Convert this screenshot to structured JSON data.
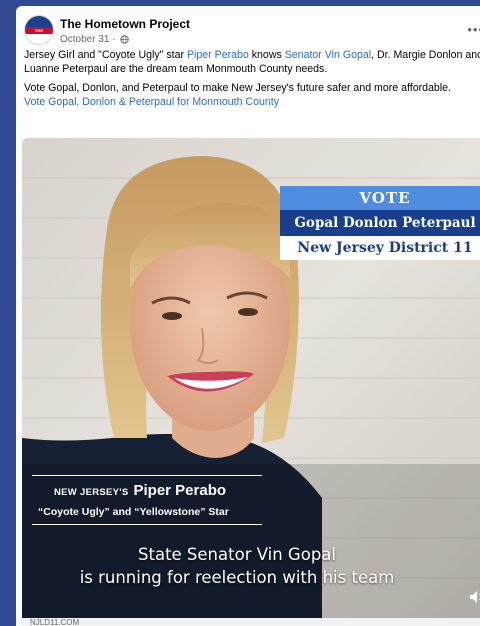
{
  "post": {
    "page_name": "The Hometown Project",
    "date": "October 31",
    "date_separator": " · ",
    "more_icon": "more-horizontal-icon",
    "privacy_icon": "globe-icon",
    "avatar_text": "THE HOMETOWN PROJECT"
  },
  "body": {
    "p1": {
      "pre": "Jersey Girl and \"Coyote Ugly\" star ",
      "link1": "Piper Perabo",
      "mid": " knows ",
      "link2": "Senator Vin Gopal",
      "post": ", Dr. Margie Donlon and",
      "line2": "Luanne Peterpaul are the dream team Monmouth County needs."
    },
    "p2": {
      "text": "Vote Gopal, Donlon, and Peterpaul to make New Jersey's future safer and more affordable.",
      "link": "Vote Gopal, Donlon & Peterpaul for Monmouth County"
    }
  },
  "video": {
    "vote_header": "VOTE",
    "vote_names": "Gopal Donlon Peterpaul",
    "vote_district": "New Jersey District 11",
    "lower_third_prefix": "NEW JERSEY'S",
    "lower_third_name": "Piper Perabo",
    "lower_third_role": "“Coyote Ugly” and “Yellowstone” Star",
    "caption_line1": "State Senator Vin Gopal",
    "caption_line2": "is running for reelection with his team",
    "volume_icon": "volume-icon"
  },
  "footer": {
    "domain": "NJLD11.COM"
  },
  "colors": {
    "background": "#2f4a93",
    "link": "#2a6bd1",
    "vote_light": "#4f8de0",
    "vote_dark": "#183e8c"
  }
}
